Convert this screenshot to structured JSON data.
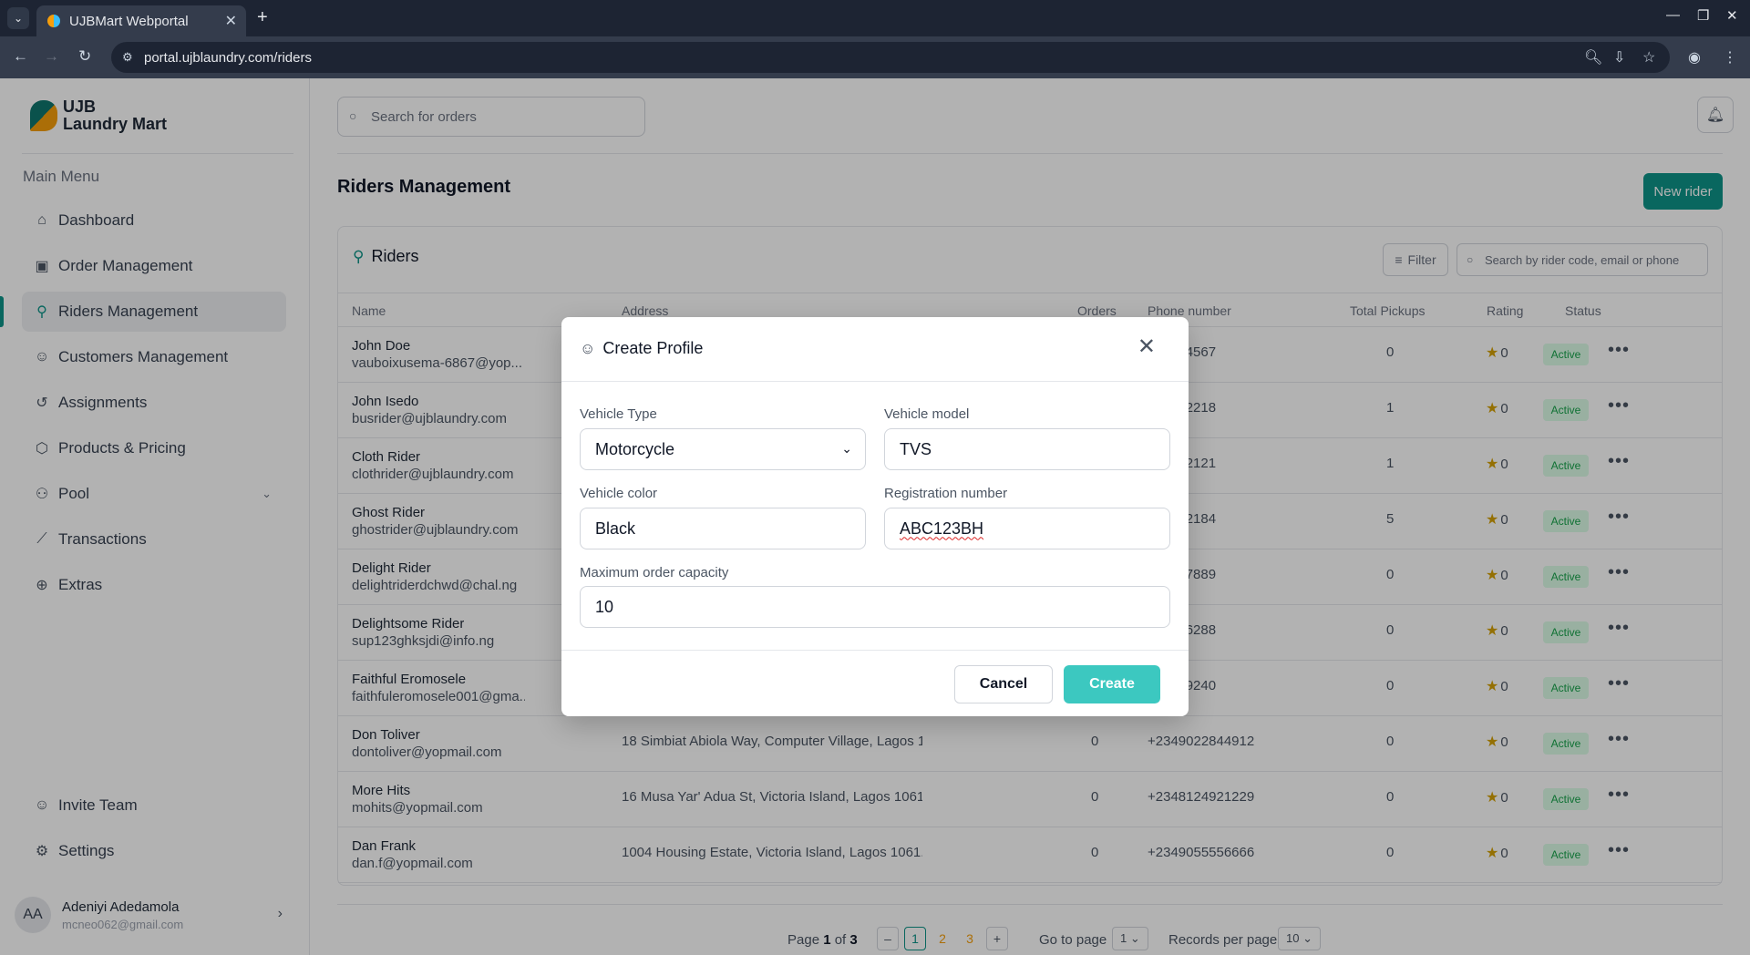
{
  "browser": {
    "tab_title": "UJBMart Webportal",
    "url": "portal.ujblaundry.com/riders"
  },
  "sidebar": {
    "logo_line1": "UJB",
    "logo_line2": "Laundry Mart",
    "menu_title": "Main Menu",
    "items": [
      {
        "label": "Dashboard",
        "icon": "home-icon"
      },
      {
        "label": "Order Management",
        "icon": "bag-icon"
      },
      {
        "label": "Riders Management",
        "icon": "bike-icon",
        "active": true
      },
      {
        "label": "Customers Management",
        "icon": "users-icon"
      },
      {
        "label": "Assignments",
        "icon": "history-icon"
      },
      {
        "label": "Products & Pricing",
        "icon": "tags-icon"
      },
      {
        "label": "Pool",
        "icon": "pool-icon"
      },
      {
        "label": "Transactions",
        "icon": "chart-line-icon"
      },
      {
        "label": "Extras",
        "icon": "globe-icon"
      }
    ],
    "invite_label": "Invite Team",
    "settings_label": "Settings",
    "user": {
      "initials": "AA",
      "name": "Adeniyi Adedamola",
      "email": "mcneo062@gmail.com"
    }
  },
  "header": {
    "search_placeholder": "Search for orders"
  },
  "page": {
    "title": "Riders Management",
    "new_button": "New rider",
    "panel_title": "Riders",
    "filter_label": "Filter",
    "panel_search_placeholder": "Search by rider code, email or phone"
  },
  "table": {
    "columns": [
      "Name",
      "Address",
      "Orders",
      "Phone number",
      "Total Pickups",
      "Rating",
      "Status"
    ],
    "rows": [
      {
        "name": "John Doe",
        "email": "vauboixusema-6867@yop...",
        "address": "",
        "orders": "",
        "phone": "061234567",
        "pickups": "0",
        "rating": "0",
        "status": "Active"
      },
      {
        "name": "John Isedo",
        "email": "busrider@ujblaundry.com",
        "address": "",
        "orders": "",
        "phone": "172812218",
        "pickups": "1",
        "rating": "0",
        "status": "Active"
      },
      {
        "name": "Cloth Rider",
        "email": "clothrider@ujblaundry.com",
        "address": "",
        "orders": "",
        "phone": "192102121",
        "pickups": "1",
        "rating": "0",
        "status": "Active"
      },
      {
        "name": "Ghost Rider",
        "email": "ghostrider@ujblaundry.com",
        "address": "",
        "orders": "",
        "phone": "132622184",
        "pickups": "5",
        "rating": "0",
        "status": "Active"
      },
      {
        "name": "Delight Rider",
        "email": "delightriderdchwd@chal.ng",
        "address": "",
        "orders": "",
        "phone": "367887889",
        "pickups": "0",
        "rating": "0",
        "status": "Active"
      },
      {
        "name": "Delightsome Rider",
        "email": "sup123ghksjdi@info.ng",
        "address": "",
        "orders": "",
        "phone": "646576288",
        "pickups": "0",
        "rating": "0",
        "status": "Active"
      },
      {
        "name": "Faithful Eromosele",
        "email": "faithfuleromosele001@gma...",
        "address": "",
        "orders": "",
        "phone": "036149240",
        "pickups": "0",
        "rating": "0",
        "status": "Active"
      },
      {
        "name": "Don Toliver",
        "email": "dontoliver@yopmail.com",
        "address": "18 Simbiat Abiola Way, Computer Village, Lagos 1...",
        "orders": "0",
        "phone": "+2349022844912",
        "pickups": "0",
        "rating": "0",
        "status": "Active"
      },
      {
        "name": "More Hits",
        "email": "mohits@yopmail.com",
        "address": "16 Musa Yar' Adua St, Victoria Island, Lagos 1061...",
        "orders": "0",
        "phone": "+2348124921229",
        "pickups": "0",
        "rating": "0",
        "status": "Active"
      },
      {
        "name": "Dan Frank",
        "email": "dan.f@yopmail.com",
        "address": "1004 Housing Estate, Victoria Island, Lagos 1061...",
        "orders": "0",
        "phone": "+2349055556666",
        "pickups": "0",
        "rating": "0",
        "status": "Active"
      }
    ]
  },
  "pagination": {
    "page_text_prefix": "Page ",
    "current": "1",
    "page_text_mid": " of ",
    "total": "3",
    "pages": [
      "1",
      "2",
      "3"
    ],
    "goto_label": "Go to page",
    "goto_value": "1",
    "records_label": "Records per page",
    "records_value": "10"
  },
  "modal": {
    "title": "Create Profile",
    "vehicle_type_label": "Vehicle Type",
    "vehicle_type_value": "Motorcycle",
    "vehicle_model_label": "Vehicle model",
    "vehicle_model_value": "TVS",
    "vehicle_color_label": "Vehicle color",
    "vehicle_color_value": "Black",
    "registration_label": "Registration number",
    "registration_value": "ABC123BH",
    "capacity_label": "Maximum order capacity",
    "capacity_value": "10",
    "cancel_label": "Cancel",
    "create_label": "Create"
  },
  "colors": {
    "accent": "#0d9488",
    "create_button": "#3cc8c0",
    "active_badge_bg": "#dcfce7",
    "active_badge_text": "#16a34a",
    "star": "#d4a106"
  }
}
